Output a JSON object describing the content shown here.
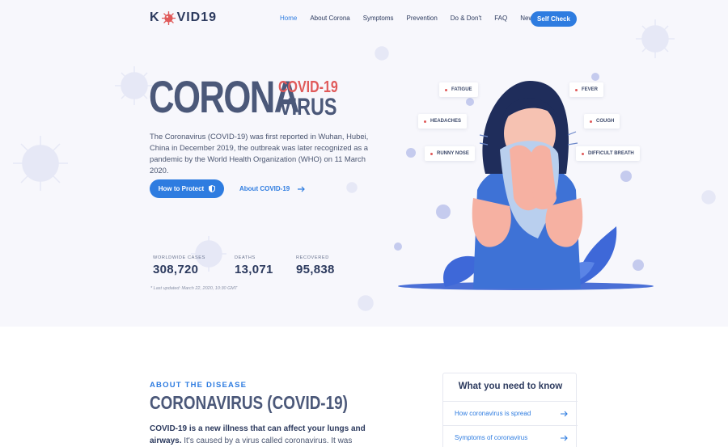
{
  "header": {
    "logo_k": "K",
    "logo_rest": "VID19",
    "nav": [
      "Home",
      "About Corona",
      "Symptoms",
      "Prevention",
      "Do & Don't",
      "FAQ",
      "News"
    ],
    "cta": "Self Check"
  },
  "hero": {
    "title_main": "CORONA",
    "title_small_top": "COVID-19",
    "title_small_bottom": "VIRUS",
    "intro": "The Coronavirus (COVID-19) was first reported in Wuhan, Hubei, China in December 2019,  the outbreak was later recognized as a pandemic by the World Health Organization (WHO) on 11 March 2020.",
    "btn_protect": "How to Protect",
    "link_about": "About COVID-19",
    "stats": [
      {
        "label": "WORLDWIDE CASES",
        "value": "308,720"
      },
      {
        "label": "DEATHS",
        "value": "13,071"
      },
      {
        "label": "RECOVERED",
        "value": "95,838"
      }
    ],
    "updated": "Last updated: March 22, 2020, 10:30 GMT",
    "symptoms": [
      "FATIGUE",
      "FEVER",
      "HEADACHES",
      "COUGH",
      "RUNNY NOSE",
      "DIFFICULT BREATH"
    ]
  },
  "about": {
    "eyebrow": "ABOUT THE DISEASE",
    "title": "CORONAVIRUS (COVID-19)",
    "body_bold": "COVID-19 is a new illness that can affect your lungs and airways.",
    "body_rest": " It's caused by a virus called coronavirus. It was discovered in December"
  },
  "know": {
    "title": "What you need to know",
    "items": [
      "How coronavirus is spread",
      "Symptoms of coronavirus"
    ]
  },
  "colors": {
    "accent": "#2e7ce0",
    "alert": "#e05a5a",
    "navy": "#2c3a5e"
  }
}
